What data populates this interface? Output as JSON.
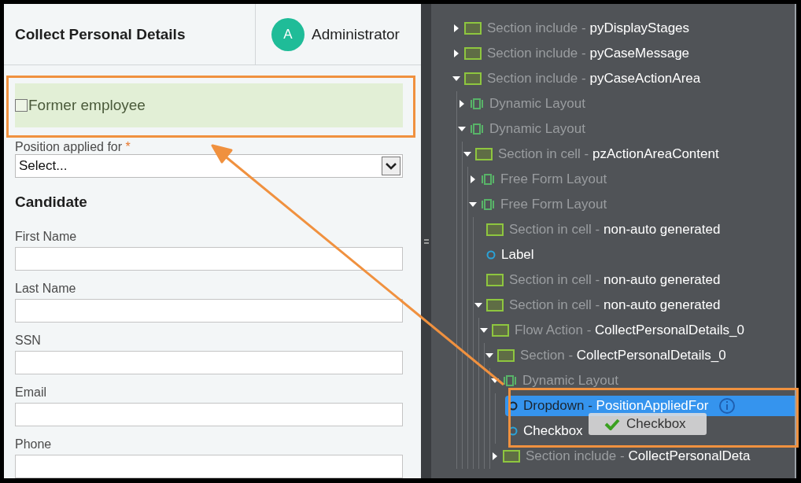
{
  "header": {
    "title": "Collect Personal Details",
    "user": {
      "initial": "A",
      "name": "Administrator"
    }
  },
  "form": {
    "former_employee": {
      "label": "Former employee",
      "checked": false
    },
    "position": {
      "label": "Position applied for",
      "required_mark": "*",
      "value": "Select..."
    },
    "section_title": "Candidate",
    "fields": [
      {
        "label": "First Name"
      },
      {
        "label": "Last Name"
      },
      {
        "label": "SSN"
      },
      {
        "label": "Email"
      },
      {
        "label": "Phone"
      }
    ]
  },
  "tree": [
    {
      "kind": "section",
      "type": "Section include -",
      "name": "pyDisplayStages",
      "expanded": false,
      "selected": false
    },
    {
      "kind": "section",
      "type": "Section include -",
      "name": "pyCaseMessage",
      "expanded": false,
      "selected": false
    },
    {
      "kind": "section",
      "type": "Section include -",
      "name": "pyCaseActionArea",
      "expanded": true,
      "selected": false,
      "children": [
        {
          "kind": "layout",
          "type": "Dynamic Layout",
          "expanded": false,
          "selected": false
        },
        {
          "kind": "layout",
          "type": "Dynamic Layout",
          "expanded": true,
          "selected": false,
          "children": [
            {
              "kind": "section",
              "type": "Section in cell -",
              "name": "pzActionAreaContent",
              "expanded": true,
              "selected": false,
              "children": [
                {
                  "kind": "layout",
                  "type": "Free Form Layout",
                  "expanded": false,
                  "selected": false
                },
                {
                  "kind": "layout",
                  "type": "Free Form Layout",
                  "expanded": true,
                  "selected": false,
                  "children": [
                    {
                      "kind": "section",
                      "type": "Section in cell -",
                      "name": "non-auto generated",
                      "selected": false
                    },
                    {
                      "kind": "field",
                      "name": "Label",
                      "selected": false
                    },
                    {
                      "kind": "section",
                      "type": "Section in cell -",
                      "name": "non-auto generated",
                      "selected": false
                    },
                    {
                      "kind": "section",
                      "type": "Section in cell -",
                      "name": "non-auto generated",
                      "expanded": true,
                      "selected": false,
                      "children": [
                        {
                          "kind": "section",
                          "type": "Flow Action -",
                          "name": "CollectPersonalDetails_0",
                          "expanded": true,
                          "selected": false,
                          "children": [
                            {
                              "kind": "section",
                              "type": "Section -",
                              "name": "CollectPersonalDetails_0",
                              "expanded": true,
                              "selected": false,
                              "children": [
                                {
                                  "kind": "layout",
                                  "type": "Dynamic Layout",
                                  "expanded": true,
                                  "selected": false,
                                  "children": [
                                    {
                                      "kind": "field",
                                      "type": "Dropdown -",
                                      "name": "PositionAppliedFor",
                                      "selected": true
                                    },
                                    {
                                      "kind": "field",
                                      "name": "Checkbox",
                                      "selected": false
                                    }
                                  ]
                                },
                                {
                                  "kind": "section",
                                  "type": "Section include -",
                                  "name": "CollectPersonalDeta",
                                  "expanded": false,
                                  "selected": false
                                }
                              ]
                            }
                          ]
                        }
                      ]
                    }
                  ]
                }
              ]
            }
          ]
        }
      ]
    }
  ],
  "drag_ghost": {
    "label": "Checkbox"
  }
}
